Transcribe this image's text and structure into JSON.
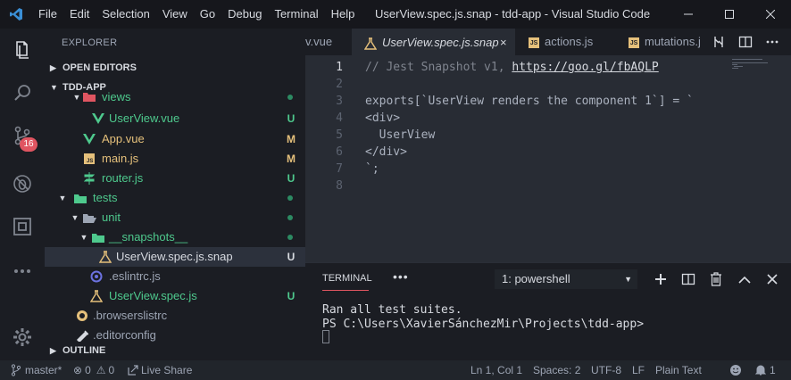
{
  "menu": [
    "File",
    "Edit",
    "Selection",
    "View",
    "Go",
    "Debug",
    "Terminal",
    "Help"
  ],
  "window_title": "UserView.spec.js.snap - tdd-app - Visual Studio Code",
  "activity": {
    "scm_badge": "16"
  },
  "sidebar": {
    "title": "EXPLORER",
    "open_editors": "OPEN EDITORS",
    "project": "TDD-APP",
    "outline": "OUTLINE",
    "tree": [
      {
        "name": "views",
        "status": ""
      },
      {
        "name": "UserView.vue",
        "status": "U"
      },
      {
        "name": "App.vue",
        "status": "M"
      },
      {
        "name": "main.js",
        "status": "M"
      },
      {
        "name": "router.js",
        "status": "U"
      },
      {
        "name": "tests",
        "status": ""
      },
      {
        "name": "unit",
        "status": ""
      },
      {
        "name": "__snapshots__",
        "status": ""
      },
      {
        "name": "UserView.spec.js.snap",
        "status": "U"
      },
      {
        "name": ".eslintrc.js",
        "status": ""
      },
      {
        "name": "UserView.spec.js",
        "status": "U"
      },
      {
        "name": ".browserslistrc",
        "status": ""
      },
      {
        "name": ".editorconfig",
        "status": ""
      }
    ]
  },
  "tabs": [
    {
      "label": "v.vue"
    },
    {
      "label": "UserView.spec.js.snap",
      "active": true
    },
    {
      "label": "actions.js"
    },
    {
      "label": "mutations.j"
    }
  ],
  "editor": {
    "line_numbers": [
      "1",
      "2",
      "3",
      "4",
      "5",
      "6",
      "7",
      "8"
    ],
    "line1_comment": "// Jest Snapshot v1, ",
    "line1_link": "https://goo.gl/fbAQLP",
    "line3": "exports[`UserView renders the component 1`] = `",
    "line4": "<div>",
    "line5": "  UserView",
    "line6": "</div>",
    "line7": "`;"
  },
  "panel": {
    "tab": "TERMINAL",
    "more": "•••",
    "select": "1: powershell",
    "lines": [
      "Ran all test suites.",
      "PS C:\\Users\\XavierSánchezMir\\Projects\\tdd-app>"
    ]
  },
  "status": {
    "branch": "master*",
    "errors": "0",
    "warnings": "0",
    "live_share": "Live Share",
    "position": "Ln 1, Col 1",
    "spaces": "Spaces: 2",
    "encoding": "UTF-8",
    "eol": "LF",
    "language": "Plain Text",
    "notifications": "1"
  },
  "colors": {
    "accent_blue": "#3a8fd6",
    "untracked_green": "#4ec98d",
    "modified_amber": "#e5c07b",
    "badge_red": "#e05561"
  }
}
